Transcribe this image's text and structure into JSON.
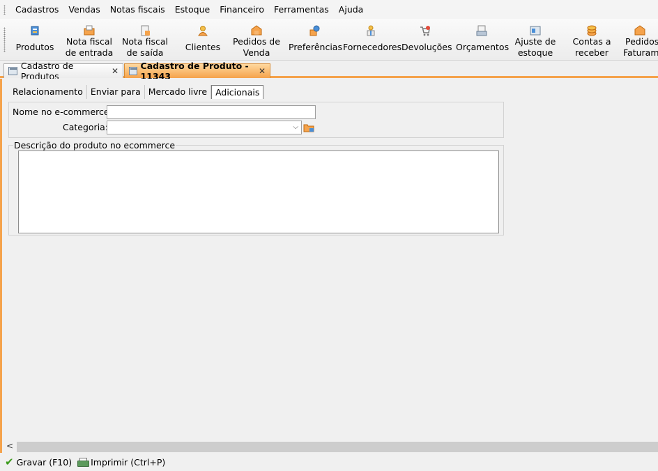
{
  "menu": [
    "Cadastros",
    "Vendas",
    "Notas fiscais",
    "Estoque",
    "Financeiro",
    "Ferramentas",
    "Ajuda"
  ],
  "toolbar": {
    "produtos": "Produtos",
    "nf_entrada_1": "Nota fiscal",
    "nf_entrada_2": "de entrada",
    "nf_saida_1": "Nota fiscal",
    "nf_saida_2": "de saída",
    "clientes": "Clientes",
    "pedidos_venda_1": "Pedidos de",
    "pedidos_venda_2": "Venda",
    "preferencias": "Preferências",
    "fornecedores": "Fornecedores",
    "devolucoes": "Devoluções",
    "orcamentos": "Orçamentos",
    "ajuste_1": "Ajuste de",
    "ajuste_2": "estoque",
    "contas_1": "Contas a",
    "contas_2": "receber",
    "pedidos_fat_1": "Pedidos",
    "pedidos_fat_2": "Faturame"
  },
  "doc_tabs": [
    "Cadastro de Produtos",
    "Cadastro de Produto - 11343"
  ],
  "sub_tabs": [
    "Relacionamento",
    "Enviar para",
    "Mercado livre",
    "Adicionais"
  ],
  "form": {
    "ecommerce_name_label": "Nome no e-commerce:",
    "ecommerce_name_value": "",
    "category_label": "Categoria:",
    "category_value": "",
    "description_legend": "Descrição do produto no ecommerce",
    "description_value": ""
  },
  "status": {
    "save": "Gravar (F10)",
    "print": "Imprimir (Ctrl+P)"
  },
  "colors": {
    "accent": "#f5a34c",
    "save_check": "#3a9a1a"
  }
}
